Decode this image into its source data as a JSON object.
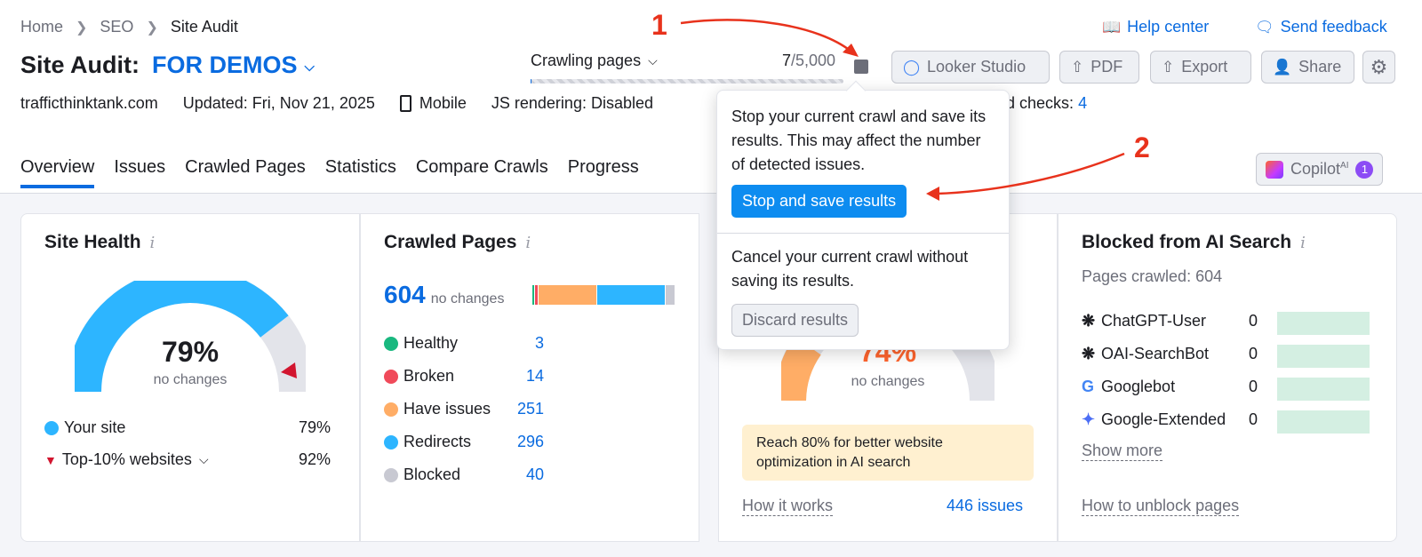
{
  "breadcrumb": [
    "Home",
    "SEO",
    "Site Audit"
  ],
  "header": {
    "title": "Site Audit:",
    "project": "FOR DEMOS",
    "domain": "trafficthinktank.com",
    "updated": "Updated: Fri, Nov 21, 2025",
    "device": "Mobile",
    "js_rendering": "JS rendering: Disabled",
    "excluded_checks_label": "ded checks:",
    "excluded_checks_value": "4"
  },
  "crawl": {
    "label": "Crawling pages",
    "done": "7",
    "total": "/5,000",
    "progress": 0.0014
  },
  "toolbar": {
    "help": "Help center",
    "feedback": "Send feedback",
    "looker": "Looker Studio",
    "pdf": "PDF",
    "export": "Export",
    "share": "Share"
  },
  "tabs": [
    "Overview",
    "Issues",
    "Crawled Pages",
    "Statistics",
    "Compare Crawls",
    "Progress"
  ],
  "copilot": {
    "label": "Copilot",
    "sup": "AI",
    "badge": "1"
  },
  "site_health": {
    "title": "Site Health",
    "value": "79%",
    "sub": "no changes",
    "your_site_label": "Your site",
    "your_site_value": "79%",
    "top10_label": "Top-10% websites",
    "top10_value": "92%",
    "fill": 0.79
  },
  "crawled_pages": {
    "title": "Crawled Pages",
    "total": "604",
    "sub": "no changes",
    "rows": [
      {
        "label": "Healthy",
        "value": "3",
        "color": "#19b87f"
      },
      {
        "label": "Broken",
        "value": "14",
        "color": "#f04a5a"
      },
      {
        "label": "Have issues",
        "value": "251",
        "color": "#ffad66"
      },
      {
        "label": "Redirects",
        "value": "296",
        "color": "#2db5ff"
      },
      {
        "label": "Blocked",
        "value": "40",
        "color": "#c8c9d2"
      }
    ]
  },
  "ai_card": {
    "value": "74%",
    "sub": "no changes",
    "note": "Reach 80% for better website optimization in AI search",
    "how": "How it works",
    "issues": "446 issues"
  },
  "blocked_ai": {
    "title": "Blocked from AI Search",
    "pages": "Pages crawled: 604",
    "bots": [
      {
        "name": "ChatGPT-User",
        "value": "0",
        "icon": "openai-icon"
      },
      {
        "name": "OAI-SearchBot",
        "value": "0",
        "icon": "openai-icon"
      },
      {
        "name": "Googlebot",
        "value": "0",
        "icon": "google-icon"
      },
      {
        "name": "Google-Extended",
        "value": "0",
        "icon": "gemini-icon"
      }
    ],
    "more": "Show more",
    "unblock": "How to unblock pages"
  },
  "popup": {
    "stop_text": "Stop your current crawl and save its results. This may affect the number of detected issues.",
    "stop_btn": "Stop and save results",
    "cancel_text": "Cancel your current crawl without saving its results.",
    "discard_btn": "Discard results"
  },
  "annotations": [
    "1",
    "2"
  ]
}
